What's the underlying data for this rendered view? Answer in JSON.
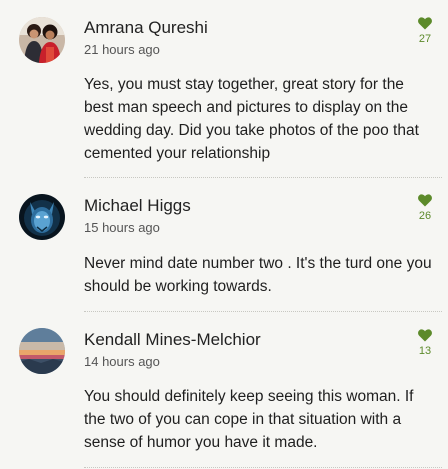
{
  "theme": {
    "heart_color": "#5c8a2a"
  },
  "comments": [
    {
      "author": "Amrana Qureshi",
      "time": "21 hours ago",
      "likes": "27",
      "avatar_icon": "couple-photo-avatar",
      "text": "Yes, you must stay together, great story for the best man speech and pictures to display on the wedding day. Did you take photos of the poo that cemented your relationship"
    },
    {
      "author": "Michael Higgs",
      "time": "15 hours ago",
      "likes": "26",
      "avatar_icon": "blue-creature-avatar",
      "text": "Never mind date number two . It's the turd one you should be working towards."
    },
    {
      "author": "Kendall Mines-Melchior",
      "time": "14 hours ago",
      "likes": "13",
      "avatar_icon": "sunset-landscape-avatar",
      "text": "You should definitely keep seeing this woman. If the two of you can cope in that situation with a sense of humor you have it made."
    }
  ]
}
